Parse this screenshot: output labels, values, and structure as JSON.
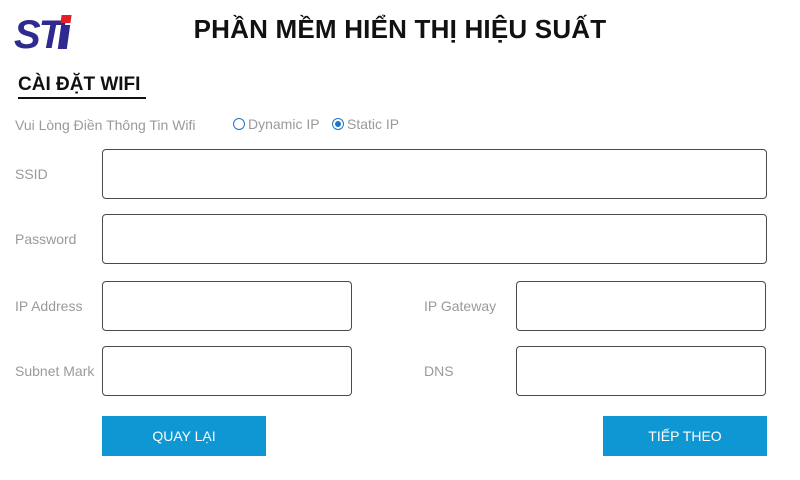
{
  "header": {
    "logo_text": "STI",
    "title": "PHẦN MỀM HIỂN THỊ HIỆU SUẤT"
  },
  "section": {
    "title": "CÀI ĐẶT WIFI"
  },
  "ip_mode": {
    "instruction": "Vui Lòng Điền Thông Tin Wifi",
    "options": [
      "Dynamic IP",
      "Static IP"
    ],
    "selected": "Static IP"
  },
  "fields": {
    "ssid": {
      "label": "SSID",
      "value": ""
    },
    "password": {
      "label": "Password",
      "value": ""
    },
    "ip_address": {
      "label": "IP Address",
      "value": ""
    },
    "ip_gateway": {
      "label": "IP Gateway",
      "value": ""
    },
    "subnet_mark": {
      "label": "Subnet Mark",
      "value": ""
    },
    "dns": {
      "label": "DNS",
      "value": ""
    }
  },
  "buttons": {
    "back": "QUAY LẠI",
    "next": "TIẾP THEO"
  },
  "colors": {
    "logo_primary": "#2e2a8f",
    "logo_accent": "#e31e24",
    "button_bg": "#0f97d3",
    "radio_accent": "#1a73c9"
  }
}
